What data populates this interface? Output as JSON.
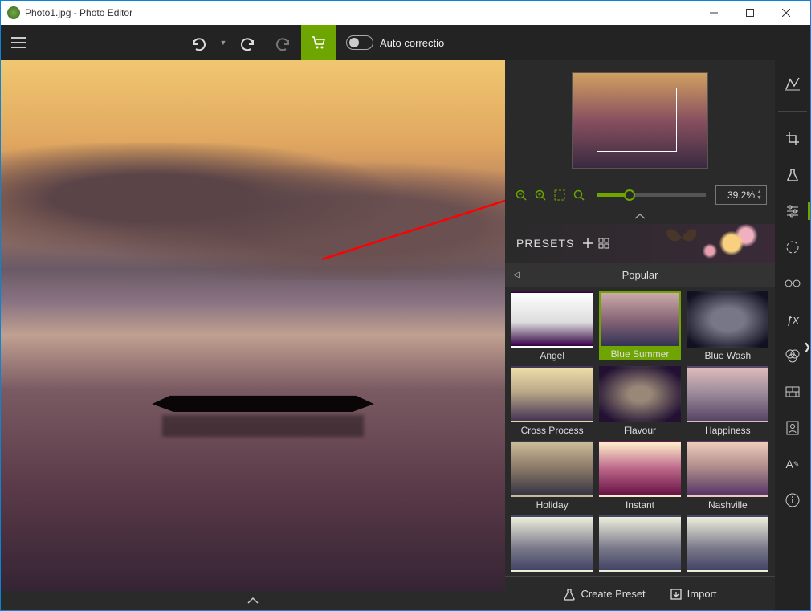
{
  "window": {
    "title": "Photo1.jpg - Photo Editor"
  },
  "toolbar": {
    "auto_label": "Auto correctio"
  },
  "zoom": {
    "value": "39.2%",
    "slider_percent": 30
  },
  "presets_header": {
    "title": "PRESETS"
  },
  "category": {
    "name": "Popular"
  },
  "presets": [
    {
      "label": "Angel",
      "cls": "th-angel"
    },
    {
      "label": "Blue Summer",
      "cls": "th-bsummer",
      "selected": true
    },
    {
      "label": "Blue Wash",
      "cls": "th-bwash"
    },
    {
      "label": "Cross Process",
      "cls": "th-cross"
    },
    {
      "label": "Flavour",
      "cls": "th-flavour"
    },
    {
      "label": "Happiness",
      "cls": "th-happy"
    },
    {
      "label": "Holiday",
      "cls": "th-holiday"
    },
    {
      "label": "Instant",
      "cls": "th-instant"
    },
    {
      "label": "Nashville",
      "cls": "th-nash"
    },
    {
      "label": "",
      "cls": "th-more"
    },
    {
      "label": "",
      "cls": "th-more"
    },
    {
      "label": "",
      "cls": "th-more"
    }
  ],
  "footer": {
    "create": "Create Preset",
    "import": "Import"
  }
}
